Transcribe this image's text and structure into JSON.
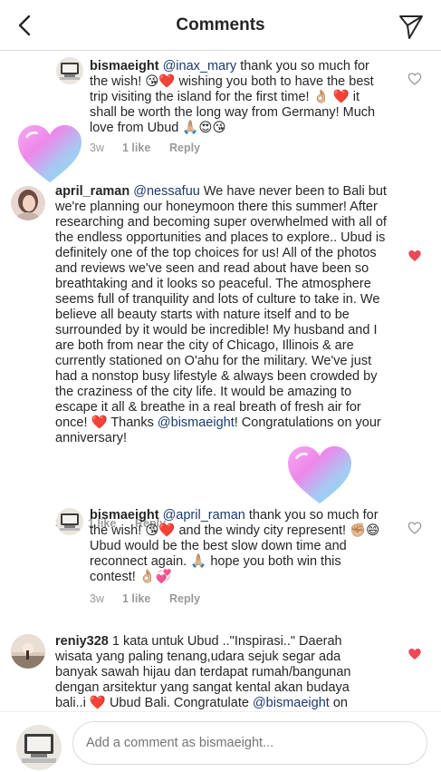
{
  "header": {
    "title": "Comments"
  },
  "comments": [
    {
      "username": "bismaeight",
      "mention": "@inax_mary",
      "text": " thank you so much for the wish! 😘❤️ wishing you both to have the best trip visiting the island for the first time! 👌🏼 ❤️ it shall be worth the long way from Germany! Much love from Ubud 🙏🏼😍😘",
      "time": "3w",
      "likes": "1 like",
      "reply": "Reply",
      "liked": false
    },
    {
      "username": "april_raman",
      "mention": "@nessafuu",
      "text": " We have never been to Bali but we're planning our honeymoon there this summer! After researching and becoming super overwhelmed with all of the endless opportunities and places to explore.. Ubud is definitely one of the top choices for us! All of the photos and reviews we've seen and read about have been so breathtaking and it looks so peaceful. The atmosphere seems full of tranquility and lots of culture to take in. We believe all beauty starts with nature itself and to be surrounded by it would be incredible! My husband and I are both from near the city of Chicago, Illinois & are currently stationed on O'ahu for the military. We've just had a nonstop busy lifestyle & always been crowded by the craziness of the city life. It would be amazing to escape it all & breathe in a real breath of fresh air for once! ❤️ Thanks ",
      "mention2": "@bismaeight",
      "text2": "! Congratulations on your anniversary!",
      "time": "3w",
      "likes": "1 like",
      "reply": "Reply",
      "liked": true
    },
    {
      "username": "bismaeight",
      "mention": "@april_raman",
      "text": " thank you so much for the wish! 😘❤️ and the windy city represent! ✊🏼😄 Ubud would be the best slow down time and reconnect again. 🙏🏼 hope you both win this contest! 👌🏼💞",
      "time": "3w",
      "likes": "1 like",
      "reply": "Reply",
      "liked": false
    },
    {
      "username": "reniy328",
      "text": " 1 kata untuk Ubud ..\"Inspirasi..\" Daerah wisata yang paling tenang,udara sejuk segar ada banyak  sawah hijau dan terdapat rumah/bangunan dengan arsitektur yang sangat kental akan budaya bali..i ❤️ Ubud Bali. Congratulate ",
      "mention2": "@bismaeight",
      "text2": " on",
      "liked": true
    }
  ],
  "footer": {
    "placeholder": "Add a comment as bismaeight..."
  },
  "icons": {
    "back": "chevron-left-icon",
    "share": "paper-plane-icon",
    "like_empty": "heart-outline-icon",
    "like_filled": "heart-filled-icon",
    "sticker": "heart-sticker"
  },
  "colors": {
    "like_red": "#ed4956",
    "text": "#262626",
    "muted": "#9a9a9a",
    "mention": "#1a3a6e"
  }
}
